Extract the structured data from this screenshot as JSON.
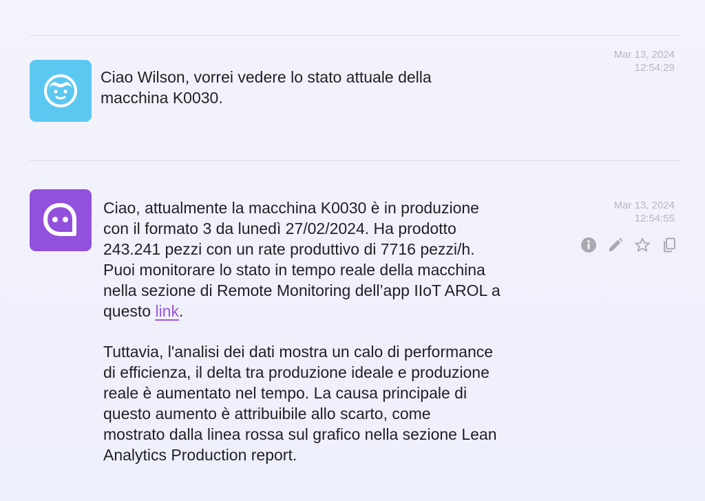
{
  "messages": [
    {
      "sender": "user",
      "avatar_icon": "user-face-icon",
      "text": "Ciao Wilson, vorrei vedere lo stato attuale della\nmacchina K0030.",
      "date": "Mar 13, 2024",
      "time": "12:54:29"
    },
    {
      "sender": "assistant",
      "avatar_icon": "chat-bubble-icon",
      "text_before_link": "Ciao, attualmente la macchina K0030 è in produzione\ncon il formato 3 da lunedì 27/02/2024. Ha prodotto\n243.241 pezzi con un rate produttivo di 7716 pezzi/h.\nPuoi monitorare lo stato in tempo reale della macchina\nnella sezione di Remote Monitoring dell’app IIoT AROL a\nquesto ",
      "link_text": "link",
      "text_after_link": ".",
      "paragraph2": "Tuttavia, l'analisi dei dati mostra un calo di performance\ndi efficienza, il delta tra produzione ideale e produzione\nreale è aumentato nel tempo. La causa principale di\nquesto aumento è attribuibile allo scarto, come\nmostrato dalla linea rossa sul grafico nella sezione Lean\nAnalytics Production report.",
      "date": "Mar 13, 2024",
      "time": "12:54:55",
      "actions": [
        "info-icon",
        "edit-pencil-icon",
        "star-icon",
        "copy-icon"
      ]
    }
  ],
  "colors": {
    "user_avatar": "#5cc8f2",
    "bot_avatar": "#9250dc",
    "link": "#9b55e0",
    "timestamp": "#b7b7c0",
    "action_icon": "#a9a9b2"
  }
}
